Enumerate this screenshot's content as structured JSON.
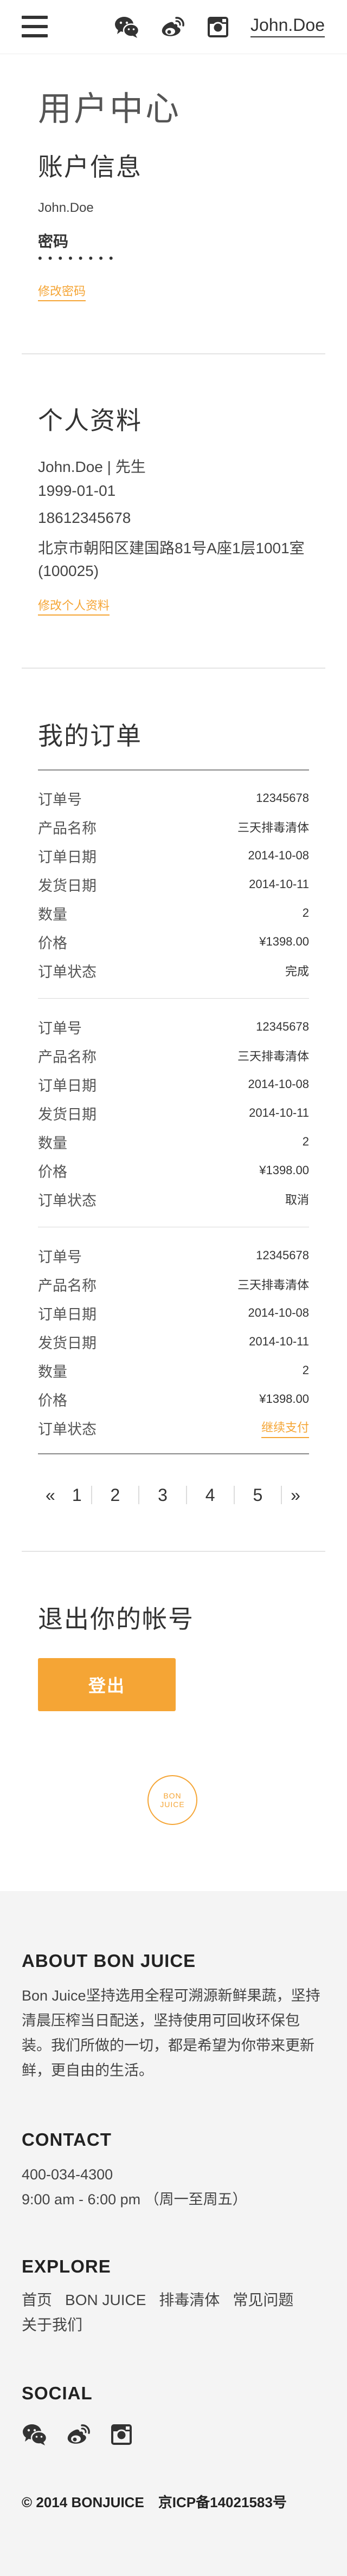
{
  "header": {
    "username": "John.Doe",
    "icons": [
      "menu-icon",
      "wechat-icon",
      "weibo-icon",
      "instagram-icon"
    ]
  },
  "page_title": "用户中心",
  "account": {
    "title": "账户信息",
    "username": "John.Doe",
    "password_label": "密码",
    "password_mask": "••••••••",
    "change_password_link": "修改密码"
  },
  "profile": {
    "title": "个人资料",
    "name_line": "John.Doe | 先生",
    "birthday": "1999-01-01",
    "phone": "18612345678",
    "address": "北京市朝阳区建国路81号A座1层1001室",
    "postcode": "(100025)",
    "edit_link": "修改个人资料"
  },
  "orders": {
    "title": "我的订单",
    "labels": {
      "order_no": "订单号",
      "product": "产品名称",
      "order_date": "订单日期",
      "ship_date": "发货日期",
      "quantity": "数量",
      "price": "价格",
      "status": "订单状态"
    },
    "items": [
      {
        "order_no": "12345678",
        "product": "三天排毒清体",
        "order_date": "2014-10-08",
        "ship_date": "2014-10-11",
        "quantity": "2",
        "price": "¥1398.00",
        "status": "完成"
      },
      {
        "order_no": "12345678",
        "product": "三天排毒清体",
        "order_date": "2014-10-08",
        "ship_date": "2014-10-11",
        "quantity": "2",
        "price": "¥1398.00",
        "status": "取消"
      },
      {
        "order_no": "12345678",
        "product": "三天排毒清体",
        "order_date": "2014-10-08",
        "ship_date": "2014-10-11",
        "quantity": "2",
        "price": "¥1398.00",
        "status": "继续支付"
      }
    ],
    "pager": {
      "prev": "«",
      "pages": [
        "1",
        "2",
        "3",
        "4",
        "5"
      ],
      "next": "»"
    }
  },
  "logout": {
    "title": "退出你的帐号",
    "button": "登出"
  },
  "brand_logo": {
    "line1": "BON",
    "line2": "JUICE"
  },
  "footer": {
    "about_title": "ABOUT BON JUICE",
    "about_text": "Bon Juice坚持选用全程可溯源新鲜果蔬，坚持清晨压榨当日配送，坚持使用可回收环保包装。我们所做的一切，都是希望为你带来更新鲜，更自由的生活。",
    "contact_title": "CONTACT",
    "phone": "400-034-4300",
    "hours": "9:00 am - 6:00 pm （周一至周五）",
    "explore_title": "EXPLORE",
    "nav": [
      "首页",
      "BON JUICE",
      "排毒清体",
      "常见问题",
      "关于我们"
    ],
    "social_title": "SOCIAL",
    "copyright": "© 2014 BONJUICE　京ICP备14021583号"
  },
  "colors": {
    "accent": "#f5a535",
    "text": "#333333",
    "footer_bg": "#f4f4f4"
  }
}
